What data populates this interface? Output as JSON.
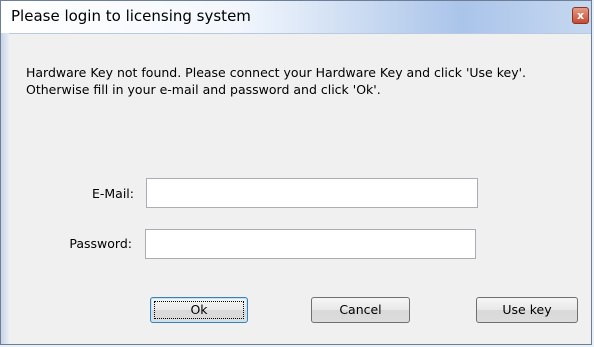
{
  "window": {
    "title": "Please login to licensing system",
    "close_label": "x"
  },
  "message": {
    "line1": "Hardware Key not found. Please connect your Hardware Key and click 'Use key'.",
    "line2": "Otherwise fill in your e-mail and password and click 'Ok'."
  },
  "form": {
    "email_label": "E-Mail:",
    "email_value": "",
    "password_label": "Password:",
    "password_value": ""
  },
  "buttons": {
    "ok": "Ok",
    "cancel": "Cancel",
    "use_key": "Use key"
  }
}
